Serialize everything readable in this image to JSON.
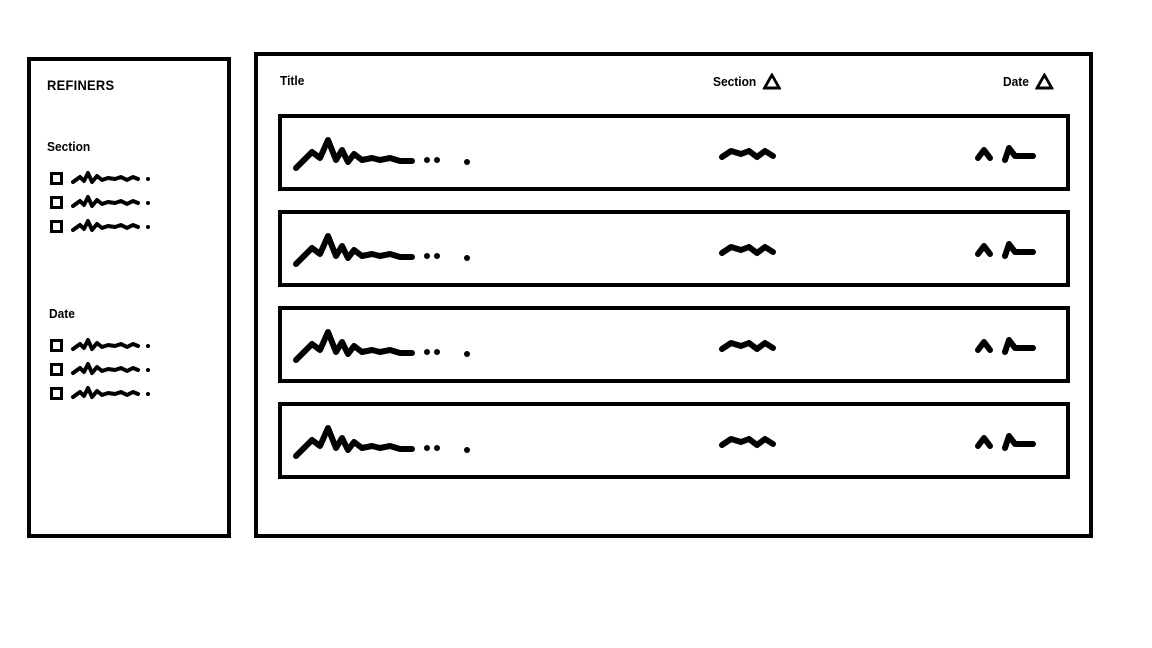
{
  "sidebar": {
    "title": "REFINERS",
    "groups": [
      {
        "heading": "Section",
        "name": "section",
        "options": [
          {
            "checked": false,
            "label_placeholder": "squiggle-line"
          },
          {
            "checked": false,
            "label_placeholder": "squiggle-line"
          },
          {
            "checked": false,
            "label_placeholder": "squiggle-line"
          }
        ]
      },
      {
        "heading": "Date",
        "name": "date",
        "options": [
          {
            "checked": false,
            "label_placeholder": "squiggle-line"
          },
          {
            "checked": false,
            "label_placeholder": "squiggle-line"
          },
          {
            "checked": false,
            "label_placeholder": "squiggle-line"
          }
        ]
      }
    ]
  },
  "main": {
    "columns": [
      {
        "label": "Title",
        "sort_icon": ""
      },
      {
        "label": "Section",
        "sort_icon": "sort-ascending-triangle-icon"
      },
      {
        "label": "Date",
        "sort_icon": "sort-ascending-triangle-icon"
      }
    ],
    "rows": [
      {
        "title_placeholder": "squiggle-line",
        "section_placeholder": "squiggle-short",
        "date_placeholder": "squiggle-date"
      },
      {
        "title_placeholder": "squiggle-line",
        "section_placeholder": "squiggle-short",
        "date_placeholder": "squiggle-date"
      },
      {
        "title_placeholder": "squiggle-line",
        "section_placeholder": "squiggle-short",
        "date_placeholder": "squiggle-date"
      },
      {
        "title_placeholder": "squiggle-line",
        "section_placeholder": "squiggle-short",
        "date_placeholder": "squiggle-date"
      }
    ]
  },
  "colors": {
    "stroke": "#000000",
    "background": "#ffffff"
  }
}
